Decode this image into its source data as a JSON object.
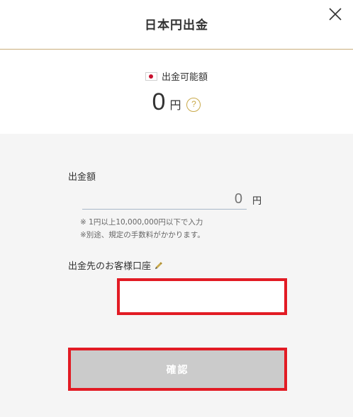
{
  "header": {
    "title": "日本円出金",
    "close_icon": "close-icon"
  },
  "summary": {
    "flag_icon": "japan-flag-icon",
    "available_label": "出金可能額",
    "available_amount": "0",
    "unit": "円",
    "help_icon_text": "?"
  },
  "form": {
    "amount_label": "出金額",
    "amount_placeholder": "0",
    "amount_unit": "円",
    "note_1": "※ 1円以上10,000,000円以下で入力",
    "note_2": "※別途、規定の手数料がかかります。",
    "account_label": "出金先のお客様口座",
    "account_edit_icon": "pencil-icon",
    "confirm_label": "確認"
  },
  "colors": {
    "gold_accent": "#c9a94a",
    "divider": "#c9ad7a",
    "highlight_red": "#e21b24",
    "disabled_button": "#cbcbcb",
    "form_background": "#f5f5f5"
  }
}
